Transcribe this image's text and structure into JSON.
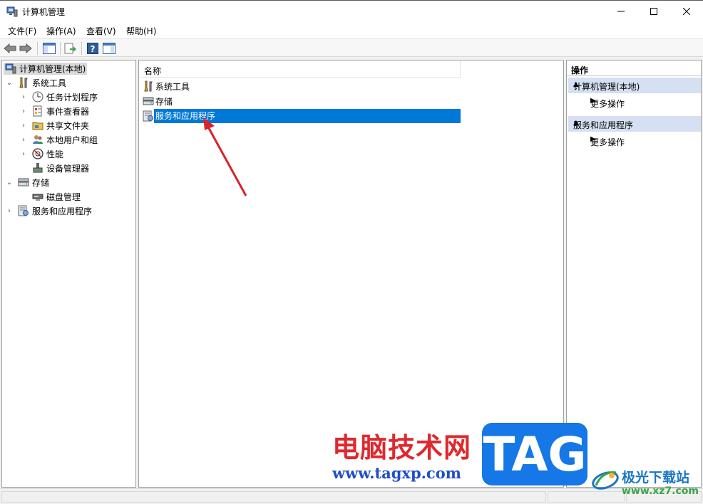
{
  "window": {
    "title": "计算机管理",
    "min_glyph": "—",
    "max_glyph": "☐",
    "close_glyph": "✕"
  },
  "menu": [
    "文件(F)",
    "操作(A)",
    "查看(V)",
    "帮助(H)"
  ],
  "tree": {
    "root": "计算机管理(本地)",
    "system_tools": "系统工具",
    "task_scheduler": "任务计划程序",
    "event_viewer": "事件查看器",
    "shared_folders": "共享文件夹",
    "local_users": "本地用户和组",
    "performance": "性能",
    "device_manager": "设备管理器",
    "storage": "存储",
    "disk_management": "磁盘管理",
    "services_apps": "服务和应用程序"
  },
  "center": {
    "column_name": "名称",
    "rows": [
      "系统工具",
      "存储",
      "服务和应用程序"
    ],
    "selected_index": 2
  },
  "actions": {
    "header": "操作",
    "groups": [
      {
        "title": "计算机管理(本地)",
        "item": "更多操作"
      },
      {
        "title": "服务和应用程序",
        "item": "更多操作"
      }
    ]
  },
  "watermark": {
    "cn_text": "电脑技术网",
    "url": "www.tagxp.com",
    "tag": "TAG",
    "site_name": "极光下载站",
    "site_url": "www.xz7.com"
  },
  "colors": {
    "selection": "#0078d7",
    "action_group_bg": "#d5e1f2",
    "annotation_arrow": "#d9232a"
  }
}
